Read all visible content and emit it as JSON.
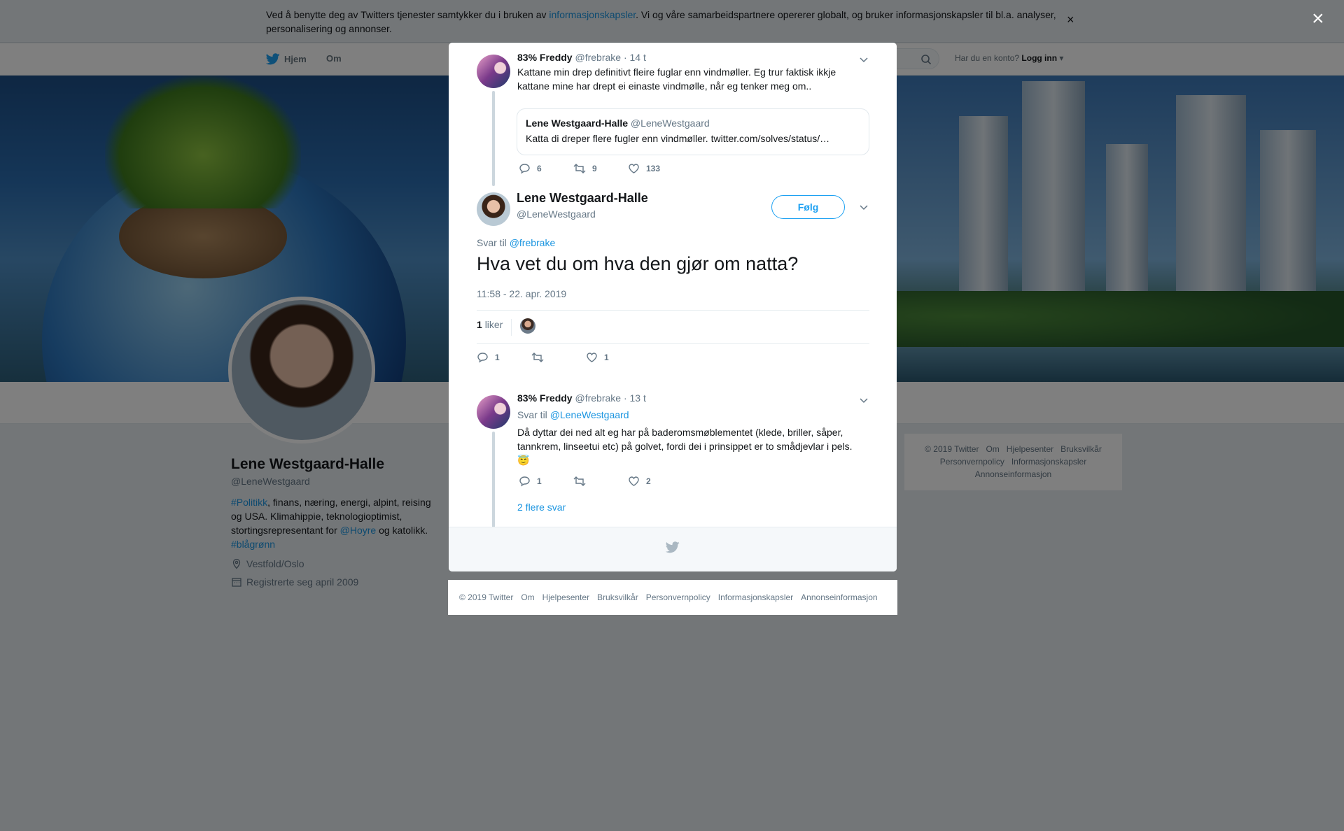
{
  "cookie_banner": {
    "text_before": "Ved å benytte deg av Twitters tjenester samtykker du i bruken av ",
    "link": "informasjonskapsler",
    "text_after": ". Vi og våre samarbeidspartnere opererer globalt, og bruker informasjonskapsler til bl.a. analyser, personalisering og annonser.",
    "close": "×"
  },
  "nav": {
    "home": "Hjem",
    "about": "Om",
    "login_prompt": "Har du en konto?",
    "login": "Logg inn"
  },
  "profile": {
    "name": "Lene Westgaard-Halle",
    "handle": "@LeneWestgaard",
    "bio": {
      "hashtag1": "#Politikk",
      "text1": ", finans, næring, energi, alpint, reising og USA. Klimahippie, teknologioptimist, stortingsrepresentant for ",
      "mention": "@Hoyre",
      "text2": " og katolikk. ",
      "hashtag2": "#blågrønn"
    },
    "location": "Vestfold/Oslo",
    "joined": "Registrerte seg april 2009"
  },
  "side_footer": {
    "row1": [
      "© 2019 Twitter",
      "Om",
      "Hjelpesenter",
      "Bruksvilkår"
    ],
    "row2": [
      "Personvernpolicy",
      "Informasjonskapsler"
    ],
    "row3": [
      "Annonseinformasjon"
    ]
  },
  "modal": {
    "close": "×",
    "tweet1": {
      "name": "83% Freddy",
      "handle": "@frebrake",
      "time": "· 14 t",
      "text": "Kattane min drep definitivt fleire fuglar enn vindmøller. Eg trur faktisk ikkje kattane mine har drept ei einaste vindmølle, når eg tenker meg om..",
      "quote": {
        "name": "Lene Westgaard-Halle",
        "handle": "@LeneWestgaard",
        "text": "Katta di dreper flere fugler enn vindmøller. twitter.com/solves/status/…"
      },
      "replies": "6",
      "retweets": "9",
      "likes": "133"
    },
    "main": {
      "name": "Lene Westgaard-Halle",
      "handle": "@LeneWestgaard",
      "follow": "Følg",
      "reply_to_label": "Svar til",
      "reply_to": "@frebrake",
      "text": "Hva vet du om hva den gjør om natta?",
      "time": "11:58 - 22. apr. 2019",
      "likes_count": "1",
      "likes_label": "liker",
      "replies": "1",
      "retweets": "",
      "likes": "1"
    },
    "tweet3": {
      "name": "83% Freddy",
      "handle": "@frebrake",
      "time": "· 13 t",
      "reply_to_label": "Svar til",
      "reply_to": "@LeneWestgaard",
      "text": "Då dyttar dei ned alt eg har på baderomsmøblementet (klede, briller, såper, tannkrem, linseetui etc) på golvet, fordi dei i prinsippet er to smådjevlar i pels.",
      "emoji": "😇",
      "replies": "1",
      "retweets": "",
      "likes": "2",
      "more_replies": "2 flere svar"
    }
  },
  "modal_footer": [
    "© 2019 Twitter",
    "Om",
    "Hjelpesenter",
    "Bruksvilkår",
    "Personvernpolicy",
    "Informasjonskapsler",
    "Annonseinformasjon"
  ]
}
